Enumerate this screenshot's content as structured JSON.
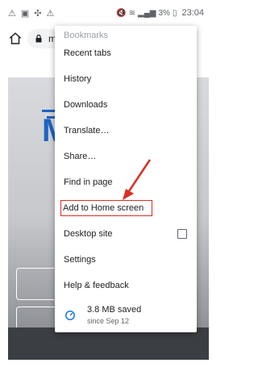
{
  "status_bar": {
    "left_icons": [
      "warning-icon",
      "image-icon",
      "vpn-icon",
      "warning-icon"
    ],
    "battery": "3%",
    "time": "23:04"
  },
  "toolbar": {
    "url_text": "m"
  },
  "menu": {
    "partial_top": "Bookmarks",
    "items": [
      {
        "label": "Recent tabs"
      },
      {
        "label": "History"
      },
      {
        "label": "Downloads"
      },
      {
        "label": "Translate…"
      },
      {
        "label": "Share…"
      },
      {
        "label": "Find in page"
      },
      {
        "label": "Add to Home screen",
        "highlighted": true
      },
      {
        "label": "Desktop site",
        "checkbox": true,
        "checked": false
      },
      {
        "label": "Settings"
      },
      {
        "label": "Help & feedback"
      }
    ],
    "savings": {
      "main": "3.8 MB saved",
      "sub": "since Sep 12"
    }
  },
  "colors": {
    "highlight_border": "#d93025",
    "arrow": "#d93025",
    "savings_icon": "#1a73e8"
  }
}
